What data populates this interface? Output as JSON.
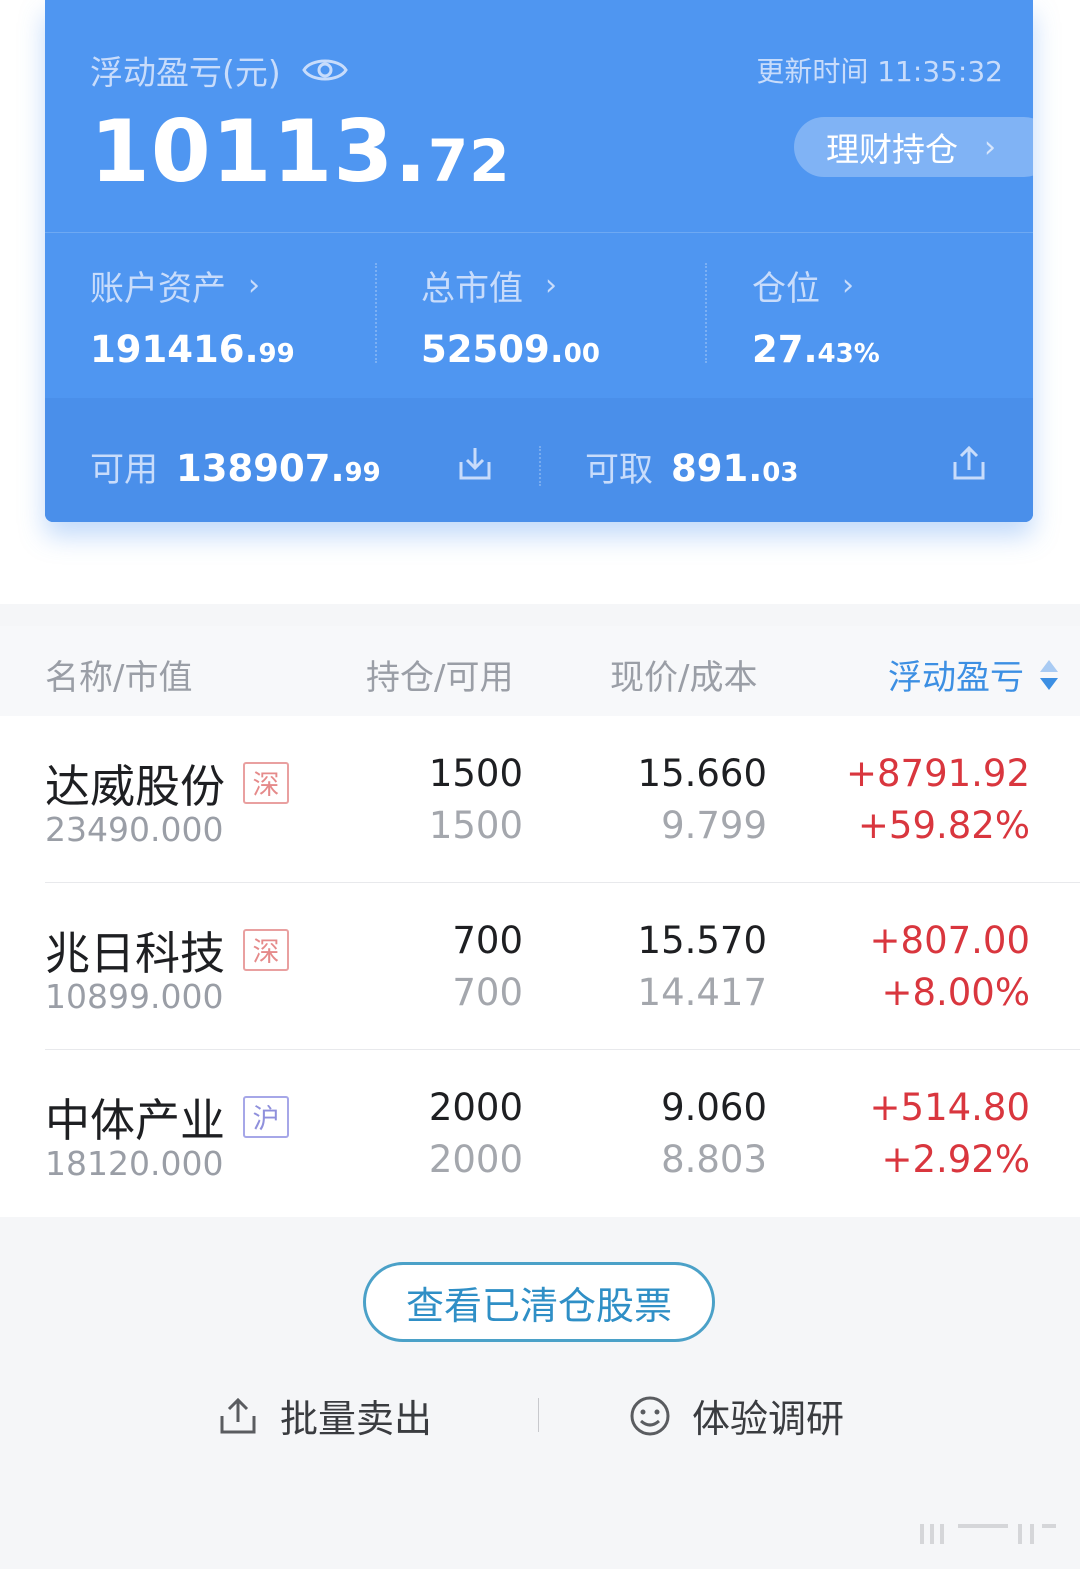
{
  "summary": {
    "pnl_label": "浮动盈亏(元)",
    "update_time": "更新时间 11:35:32",
    "pnl_int": "10113.",
    "pnl_dec": "72",
    "wealth_button": "理财持仓",
    "metrics": [
      {
        "label": "账户资产",
        "int": "191416.",
        "dec": "99"
      },
      {
        "label": "总市值",
        "int": "52509.",
        "dec": "00"
      },
      {
        "label": "仓位",
        "int": "27.",
        "dec": "43%"
      }
    ],
    "available": {
      "label": "可用",
      "int": "138907.",
      "dec": "99"
    },
    "withdrawable": {
      "label": "可取",
      "int": "891.",
      "dec": "03"
    }
  },
  "table": {
    "headers": {
      "name": "名称/市值",
      "position": "持仓/可用",
      "price": "现价/成本",
      "pnl": "浮动盈亏"
    },
    "rows": [
      {
        "name": "达威股份",
        "market": "深",
        "value": "23490.000",
        "hold": "1500",
        "avail": "1500",
        "price": "15.660",
        "cost": "9.799",
        "pnl": "+8791.92",
        "pct": "+59.82%"
      },
      {
        "name": "兆日科技",
        "market": "深",
        "value": "10899.000",
        "hold": "700",
        "avail": "700",
        "price": "15.570",
        "cost": "14.417",
        "pnl": "+807.00",
        "pct": "+8.00%"
      },
      {
        "name": "中体产业",
        "market": "沪",
        "value": "18120.000",
        "hold": "2000",
        "avail": "2000",
        "price": "9.060",
        "cost": "8.803",
        "pnl": "+514.80",
        "pct": "+2.92%"
      }
    ]
  },
  "footer": {
    "cleared_button": "查看已清仓股票",
    "batch_sell": "批量卖出",
    "survey": "体验调研"
  },
  "colors": {
    "accent": "#4f96f1",
    "profit": "#d9363e",
    "link": "#3c8fe3"
  },
  "icons": [
    "eye-icon",
    "chevron-right-icon",
    "download-icon",
    "upload-icon",
    "sort-icon",
    "share-icon",
    "smiley-icon"
  ]
}
